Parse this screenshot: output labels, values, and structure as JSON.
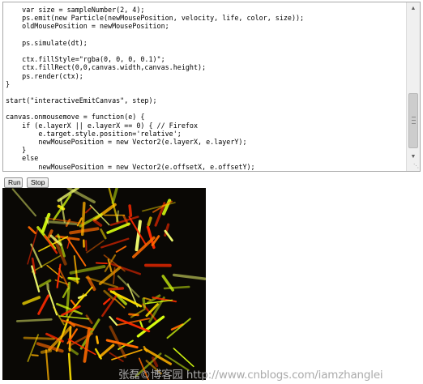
{
  "editor": {
    "code_lines": [
      "    var size = sampleNumber(2, 4);",
      "    ps.emit(new Particle(newMousePosition, velocity, life, color, size));",
      "    oldMousePosition = newMousePosition;",
      "",
      "    ps.simulate(dt);",
      "",
      "    ctx.fillStyle=\"rgba(0, 0, 0, 0.1)\";",
      "    ctx.fillRect(0,0,canvas.width,canvas.height);",
      "    ps.render(ctx);",
      "}",
      "",
      "start(\"interactiveEmitCanvas\", step);",
      "",
      "canvas.onmousemove = function(e) {",
      "    if (e.layerX || e.layerX == 0) { // Firefox",
      "        e.target.style.position='relative';",
      "        newMousePosition = new Vector2(e.layerX, e.layerY);",
      "    }",
      "    else",
      "        newMousePosition = new Vector2(e.offsetX, e.offsetY);"
    ],
    "scroll_up_icon": "triangle-up-icon",
    "scroll_down_icon": "triangle-down-icon",
    "resize_icon": "resize-grip-icon"
  },
  "buttons": {
    "run_label": "Run",
    "stop_label": "Stop"
  },
  "canvas": {
    "background": "#0a0805",
    "particle_colors": [
      "#ff2a00",
      "#ff6a00",
      "#ffb000",
      "#ffe000",
      "#d8ff10",
      "#f4ff70"
    ]
  },
  "watermark": "张磊©博客园 http://www.cnblogs.com/iamzhanglei"
}
